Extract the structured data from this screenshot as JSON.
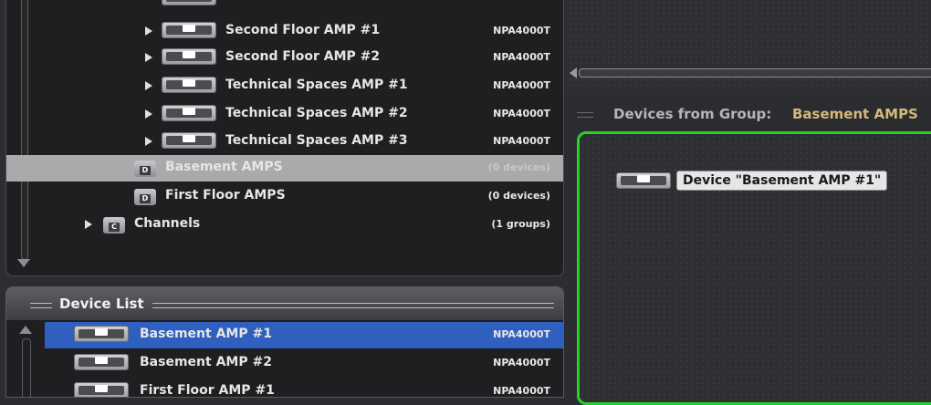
{
  "tree": {
    "items": [
      {
        "label": "Second Floor AMP #1",
        "meta": "NPA4000T"
      },
      {
        "label": "Second Floor AMP #2",
        "meta": "NPA4000T"
      },
      {
        "label": "Technical Spaces AMP #1",
        "meta": "NPA4000T"
      },
      {
        "label": "Technical Spaces AMP #2",
        "meta": "NPA4000T"
      },
      {
        "label": "Technical Spaces AMP #3",
        "meta": "NPA4000T"
      }
    ],
    "groups": [
      {
        "label": "Basement AMPS",
        "meta": "(0 devices)",
        "folder_letter": "D"
      },
      {
        "label": "First Floor AMPS",
        "meta": "(0 devices)",
        "folder_letter": "D"
      }
    ],
    "channels": {
      "label": "Channels",
      "meta": "(1 groups)",
      "folder_letter": "C"
    }
  },
  "device_list": {
    "title": "Device List",
    "items": [
      {
        "label": "Basement AMP #1",
        "meta": "NPA4000T"
      },
      {
        "label": "Basement AMP #2",
        "meta": "NPA4000T"
      },
      {
        "label": "First Floor AMP #1",
        "meta": "NPA4000T"
      }
    ]
  },
  "group_panel": {
    "title_prefix": "Devices from Group:",
    "group_name": "Basement AMPS",
    "device_chip": "Device \"Basement AMP #1\""
  },
  "colors": {
    "selection_blue": "#2f5fbf",
    "drop_border_green": "#27d127",
    "group_name_gold": "#d6b87a"
  }
}
